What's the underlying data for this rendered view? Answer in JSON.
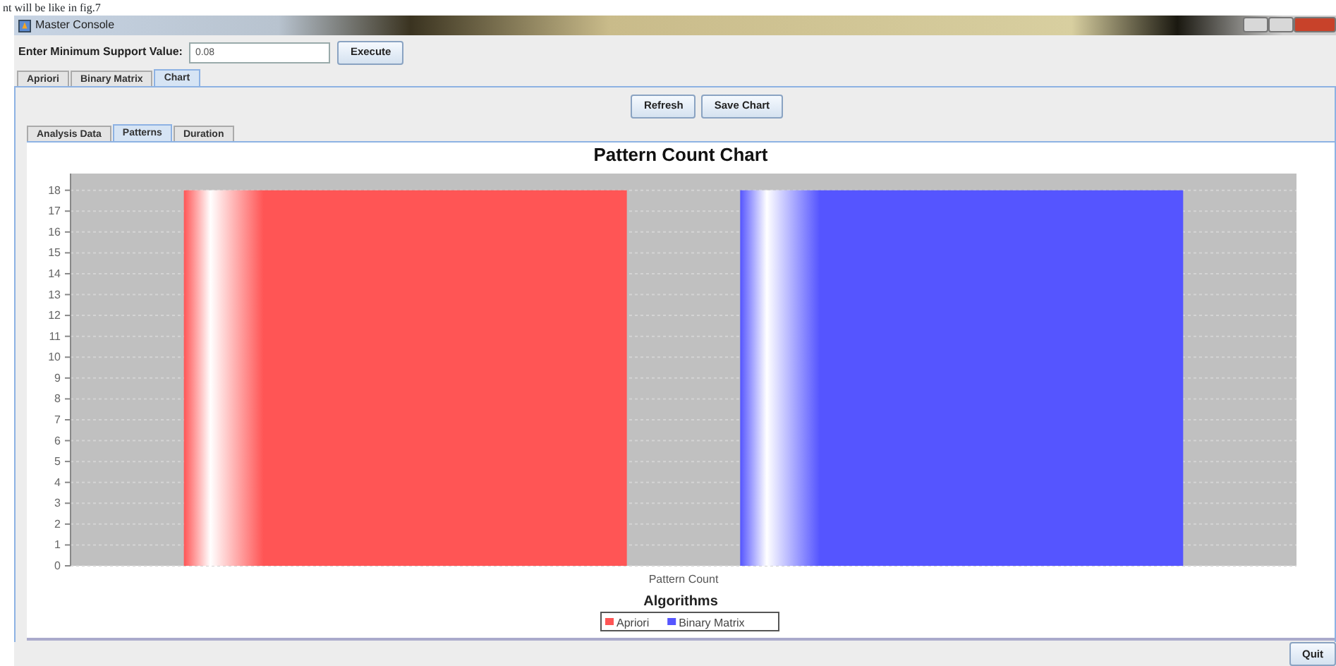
{
  "document_caption": "nt will be like in fig.7",
  "window": {
    "title": "Master Console"
  },
  "support": {
    "label": "Enter Minimum Support Value:",
    "value": "0.08",
    "button": "Execute"
  },
  "tabs": [
    {
      "label": "Apriori",
      "selected": false
    },
    {
      "label": "Binary Matrix",
      "selected": false
    },
    {
      "label": "Chart",
      "selected": true
    }
  ],
  "chart_buttons": [
    "Refresh",
    "Save Chart"
  ],
  "subtabs": [
    {
      "label": "Analysis Data",
      "selected": false
    },
    {
      "label": "Patterns",
      "selected": true
    },
    {
      "label": "Duration",
      "selected": false
    }
  ],
  "chart_data": {
    "type": "bar",
    "title": "Pattern Count Chart",
    "xlabel": "Algorithms",
    "categories": [
      "Pattern Count"
    ],
    "series": [
      {
        "name": "Apriori",
        "color": "#ff5555",
        "values": [
          18
        ]
      },
      {
        "name": "Binary Matrix",
        "color": "#5555ff",
        "values": [
          18
        ]
      }
    ],
    "grid": true,
    "legend": true,
    "ylim": [
      0,
      18.8
    ],
    "yticks": [
      0,
      1,
      2,
      3,
      4,
      5,
      6,
      7,
      8,
      9,
      10,
      11,
      12,
      13,
      14,
      15,
      16,
      17,
      18
    ]
  },
  "quit_button": "Quit"
}
